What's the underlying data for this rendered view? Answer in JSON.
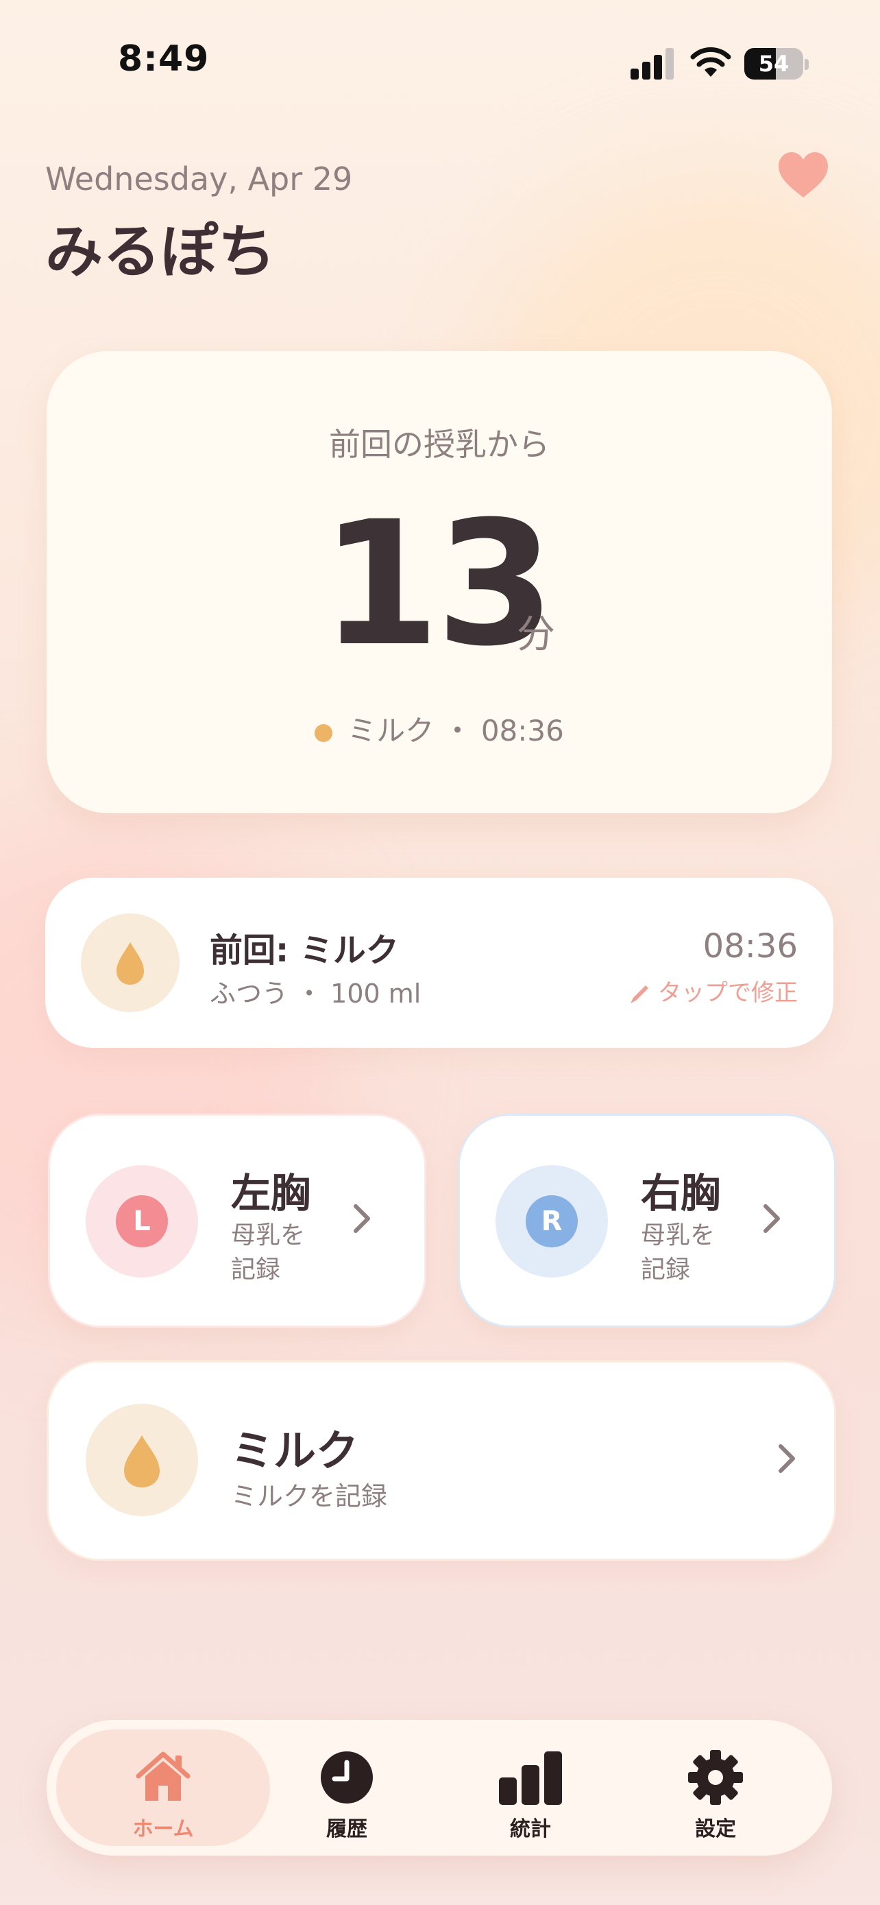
{
  "status_bar": {
    "time": "8:49",
    "battery": "54",
    "battery_level": 0.54
  },
  "header": {
    "date": "Wednesday, Apr 29",
    "title": "みるぽち"
  },
  "hero": {
    "label": "前回の授乳から",
    "value": "13",
    "unit": "分",
    "detail": "ミルク ・ 08:36"
  },
  "last_feed": {
    "title": "前回: ミルク",
    "detail": "ふつう ・ 100 ml",
    "time": "08:36",
    "edit_hint": "タップで修正"
  },
  "left_breast": {
    "badge": "L",
    "title": "左胸",
    "subtitle": "母乳を記録"
  },
  "right_breast": {
    "badge": "R",
    "title": "右胸",
    "subtitle": "母乳を記録"
  },
  "milk": {
    "title": "ミルク",
    "subtitle": "ミルクを記録"
  },
  "tabs": [
    {
      "label": "ホーム",
      "icon": "home-icon",
      "active": true
    },
    {
      "label": "履歴",
      "icon": "clock-icon",
      "active": false
    },
    {
      "label": "統計",
      "icon": "bar-chart-icon",
      "active": false
    },
    {
      "label": "設定",
      "icon": "gear-icon",
      "active": false
    }
  ],
  "colors": {
    "accent": "#ee8a74",
    "milk": "#eeb466",
    "left": "#f38d93",
    "right": "#87b0e4",
    "text": "#3d2f33"
  }
}
